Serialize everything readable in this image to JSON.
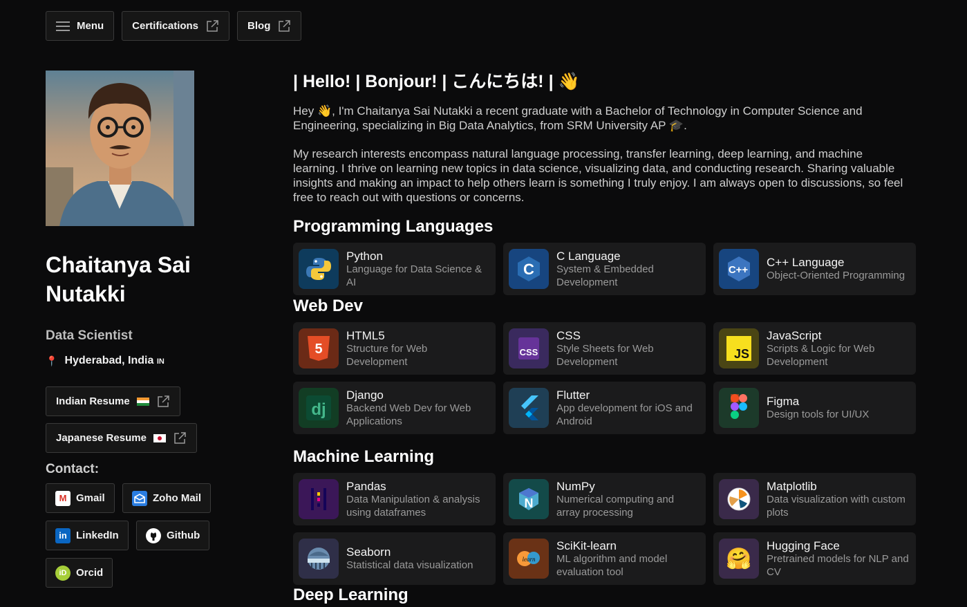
{
  "topbar": {
    "menu_label": "Menu",
    "certifications_label": "Certifications",
    "blog_label": "Blog"
  },
  "profile": {
    "name": "Chaitanya Sai Nutakki",
    "role": "Data Scientist",
    "location": "Hyderabad, India",
    "country_code": "IN",
    "indian_resume": "Indian Resume",
    "japanese_resume": "Japanese Resume",
    "contact_title": "Contact:",
    "contacts": {
      "gmail": "Gmail",
      "zoho": "Zoho Mail",
      "linkedin": "LinkedIn",
      "github": "Github",
      "orcid": "Orcid"
    }
  },
  "intro": {
    "greeting": "| Hello! | Bonjour! | こんにちは! | 👋",
    "para1": "Hey 👋, I'm Chaitanya Sai Nutakki a recent graduate with a Bachelor of Technology in Computer Science and Engineering, specializing in Big Data Analytics, from SRM University AP 🎓.",
    "para2": "My research interests encompass natural language processing, transfer learning, deep learning, and machine learning. I thrive on learning new topics in data science, visualizing data, and conducting research. Sharing valuable insights and making an impact to help others learn is something I truly enjoy. I am always open to discussions, so feel free to reach out with questions or concerns."
  },
  "sections": {
    "programming": "Programming Languages",
    "webdev": "Web Dev",
    "ml": "Machine Learning",
    "dl": "Deep Learning"
  },
  "cards": {
    "python": {
      "title": "Python",
      "desc": "Language for Data Science & AI"
    },
    "c": {
      "title": "C Language",
      "desc": "System & Embedded Development"
    },
    "cpp": {
      "title": "C++ Language",
      "desc": "Object-Oriented Programming"
    },
    "html5": {
      "title": "HTML5",
      "desc": "Structure for Web Development"
    },
    "css": {
      "title": "CSS",
      "desc": "Style Sheets for Web Development"
    },
    "js": {
      "title": "JavaScript",
      "desc": "Scripts & Logic for Web Development"
    },
    "django": {
      "title": "Django",
      "desc": "Backend Web Dev for Web Applications"
    },
    "flutter": {
      "title": "Flutter",
      "desc": "App development for iOS and Android"
    },
    "figma": {
      "title": "Figma",
      "desc": "Design tools for UI/UX"
    },
    "pandas": {
      "title": "Pandas",
      "desc": "Data Manipulation & analysis using dataframes"
    },
    "numpy": {
      "title": "NumPy",
      "desc": "Numerical computing and array processing"
    },
    "matplotlib": {
      "title": "Matplotlib",
      "desc": "Data visualization with custom plots"
    },
    "seaborn": {
      "title": "Seaborn",
      "desc": "Statistical data visualization"
    },
    "sklearn": {
      "title": "SciKit-learn",
      "desc": "ML algorithm and model evaluation tool"
    },
    "huggingface": {
      "title": "Hugging Face",
      "desc": "Pretrained models for NLP and CV"
    }
  },
  "icon_glyphs": {
    "c": "C",
    "cpp": "C++",
    "html5": "5",
    "css": "CSS",
    "js": "JS",
    "django": "dj",
    "numpy": "N",
    "sklearn": "learn",
    "huggingface": "🤗",
    "orcid": "iD",
    "linkedin": "in",
    "gmail": "M"
  },
  "colors": {
    "background": "#0b0b0c",
    "card": "#1b1b1c",
    "muted_text": "#9a9a9a"
  }
}
